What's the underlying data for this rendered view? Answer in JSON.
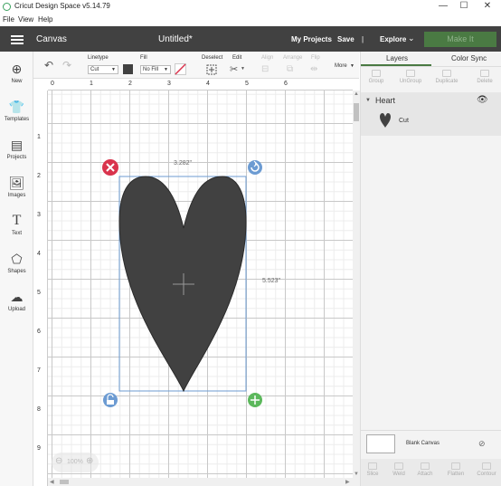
{
  "window": {
    "title": "Cricut Design Space  v5.14.79",
    "minimize": "—",
    "maximize": "☐",
    "close": "✕"
  },
  "menu": [
    "File",
    "View",
    "Help"
  ],
  "header": {
    "section": "Canvas",
    "doc_title": "Untitled*",
    "my_projects": "My Projects",
    "save": "Save",
    "separator": "|",
    "explore": "Explore",
    "make_it": "Make It"
  },
  "sidebar": [
    {
      "label": "New",
      "icon": "plus-icon"
    },
    {
      "label": "Templates",
      "icon": "shirt-icon"
    },
    {
      "label": "Projects",
      "icon": "projects-icon"
    },
    {
      "label": "Images",
      "icon": "image-icon"
    },
    {
      "label": "Text",
      "icon": "text-icon"
    },
    {
      "label": "Shapes",
      "icon": "shapes-icon"
    },
    {
      "label": "Upload",
      "icon": "upload-icon"
    }
  ],
  "toolbar": {
    "linetype_label": "Linetype",
    "linetype_value": "Cut",
    "fill_label": "Fill",
    "fill_value": "No Fill",
    "deselect": "Deselect",
    "edit": "Edit",
    "align": "Align",
    "arrange": "Arrange",
    "flip": "Flip",
    "more": "More"
  },
  "ruler": {
    "h": [
      "0",
      "1",
      "2",
      "3",
      "4",
      "5",
      "6"
    ],
    "v": [
      "1",
      "2",
      "3",
      "4",
      "5",
      "6",
      "7",
      "8",
      "9"
    ]
  },
  "canvas": {
    "width_label": "3.282\"",
    "height_label": "5.523\"",
    "zoom": "100%",
    "shape_color": "#414141",
    "selection_color": "#6c9bd2",
    "delete_color": "#d9334c",
    "rotate_color": "#6c9bd2",
    "size_color": "#5cb85c"
  },
  "panel": {
    "tab_layers": "Layers",
    "tab_color_sync": "Color Sync",
    "actions_top": [
      "Group",
      "UnGroup",
      "Duplicate",
      "Delete"
    ],
    "layer_group": "Heart",
    "layer_item": "Cut",
    "blank_canvas": "Blank Canvas",
    "actions_bottom": [
      "Slice",
      "Weld",
      "Attach",
      "Flatten",
      "Contour"
    ]
  }
}
